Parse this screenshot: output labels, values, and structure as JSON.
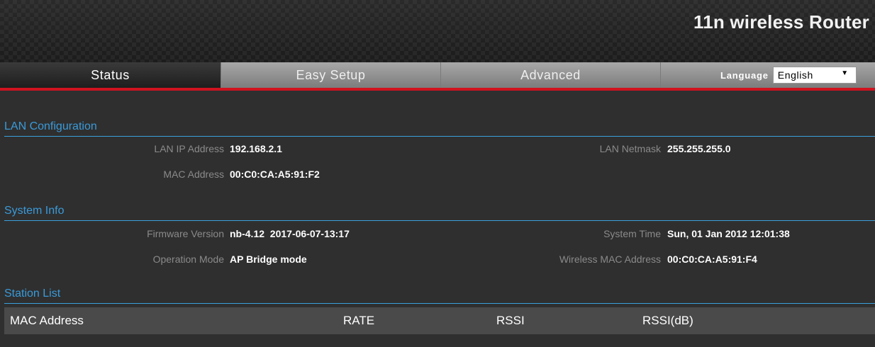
{
  "header": {
    "brand": "11n wireless Router"
  },
  "nav": {
    "tabs": [
      {
        "label": "Status"
      },
      {
        "label": "Easy Setup"
      },
      {
        "label": "Advanced"
      }
    ],
    "language_label": "Language",
    "language_value": "English"
  },
  "lan": {
    "title": "LAN Configuration",
    "ip_label": "LAN IP Address",
    "ip_value": "192.168.2.1",
    "netmask_label": "LAN Netmask",
    "netmask_value": "255.255.255.0",
    "mac_label": "MAC Address",
    "mac_value": "00:C0:CA:A5:91:F2"
  },
  "system": {
    "title": "System Info",
    "fw_label": "Firmware Version",
    "fw_value": "nb-4.12  2017-06-07-13:17",
    "time_label": "System Time",
    "time_value": "Sun, 01 Jan 2012 12:01:38",
    "mode_label": "Operation Mode",
    "mode_value": "AP Bridge mode",
    "wmac_label": "Wireless MAC Address",
    "wmac_value": "00:C0:CA:A5:91:F4"
  },
  "station": {
    "title": "Station List",
    "columns": [
      "MAC Address",
      "RATE",
      "RSSI",
      "RSSI(dB)"
    ]
  },
  "colors": {
    "accent": "#3a9ad9",
    "nav_underline": "#d0121f"
  }
}
